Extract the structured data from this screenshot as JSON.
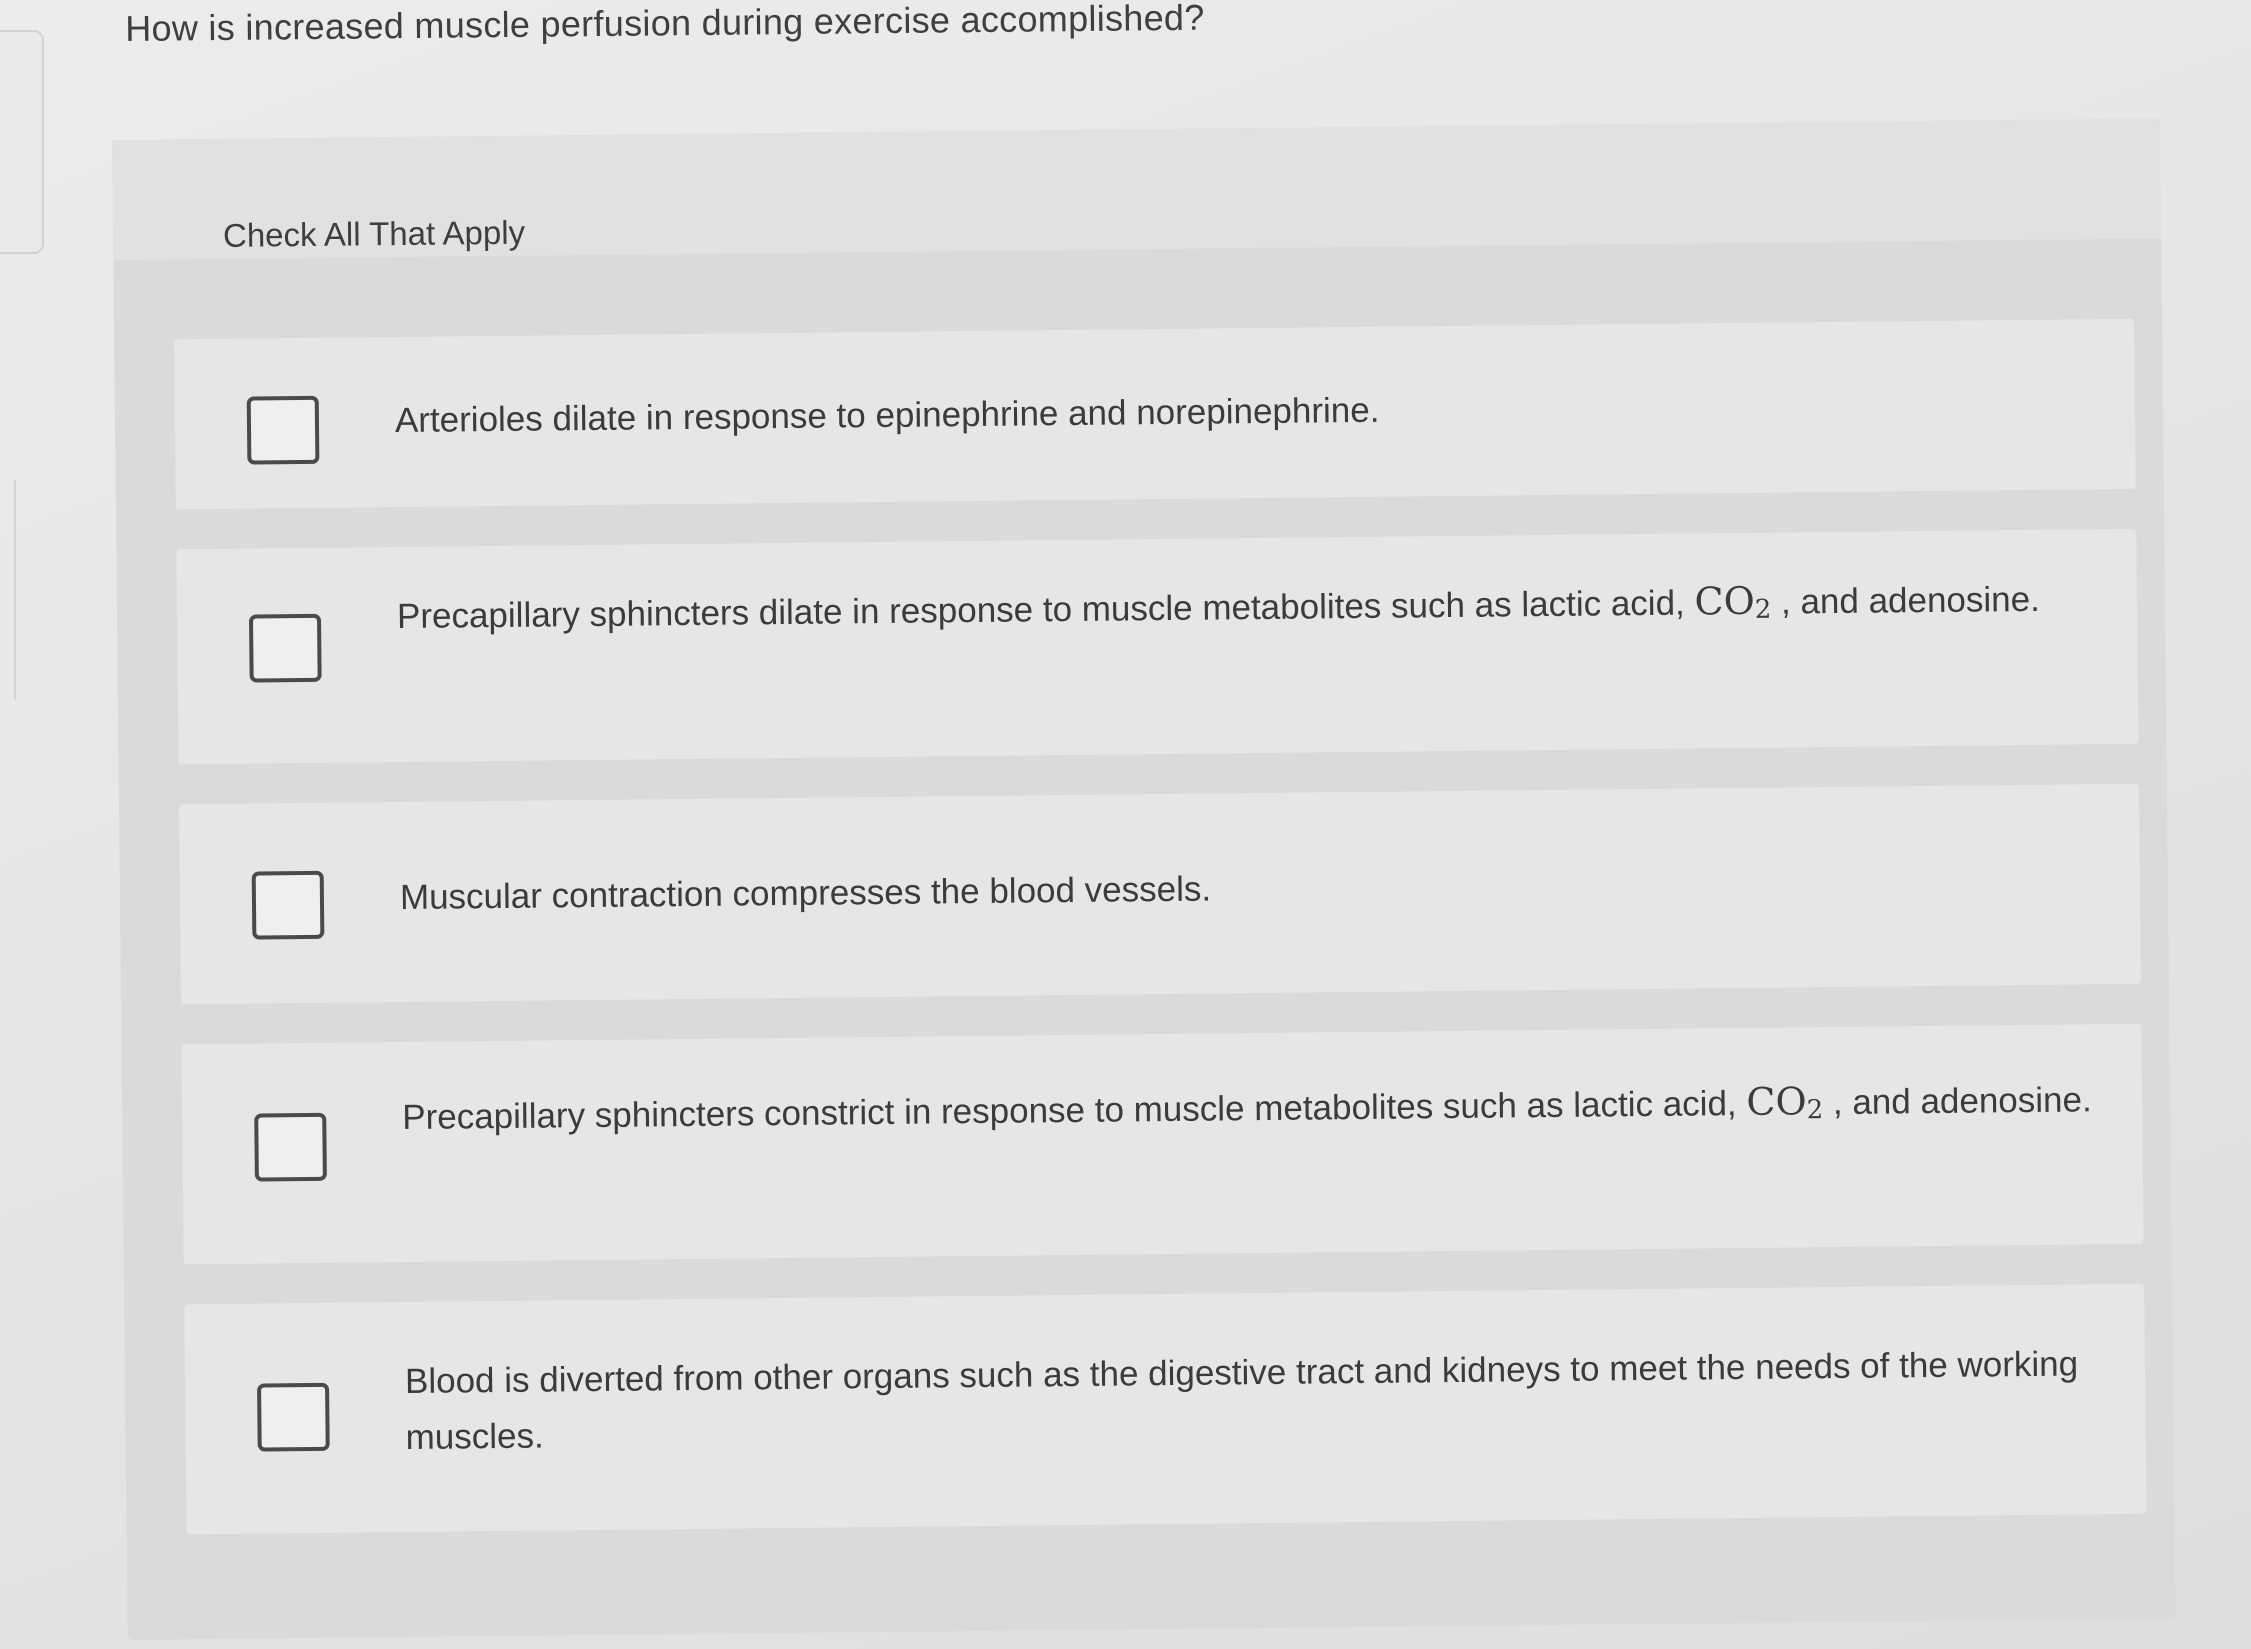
{
  "question": {
    "text": "How is increased muscle perfusion during exercise accomplished?"
  },
  "instructions": "Check All That Apply",
  "options": [
    {
      "text": "Arterioles dilate in response to epinephrine and norepinephrine.",
      "checked": false
    },
    {
      "text_before": "Precapillary sphincters dilate in response to muscle metabolites such as lactic acid,",
      "chem_main": "CO",
      "chem_sub": "2",
      "text_after": ", and adenosine.",
      "checked": false
    },
    {
      "text": "Muscular contraction compresses the blood vessels.",
      "checked": false
    },
    {
      "text_before": "Precapillary sphincters constrict in response to muscle metabolites such as lactic acid,",
      "chem_main": "CO",
      "chem_sub": "2",
      "text_after": ", and adenosine.",
      "checked": false
    },
    {
      "text": "Blood is diverted from other organs such as the digestive tract and kidneys to meet the needs of the working muscles.",
      "checked": false
    }
  ]
}
